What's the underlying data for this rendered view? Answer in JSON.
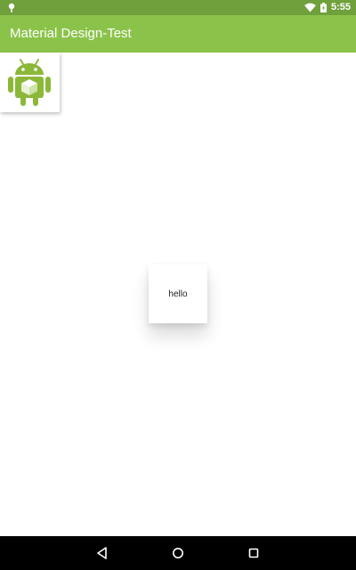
{
  "status_bar": {
    "time": "5:55",
    "icons": [
      "notification-icon",
      "wifi-icon",
      "battery-icon"
    ]
  },
  "app_bar": {
    "title": "Material Design-Test",
    "color": "#8bc34a"
  },
  "content": {
    "image_card": {
      "icon": "android-robot-icon"
    },
    "hello_card": {
      "text": "hello"
    }
  },
  "nav_bar": {
    "buttons": [
      "back-icon",
      "home-icon",
      "recents-icon"
    ]
  },
  "colors": {
    "status_bar": "#6fa03b",
    "app_bar": "#8bc34a",
    "android_green": "#8cb83a"
  }
}
